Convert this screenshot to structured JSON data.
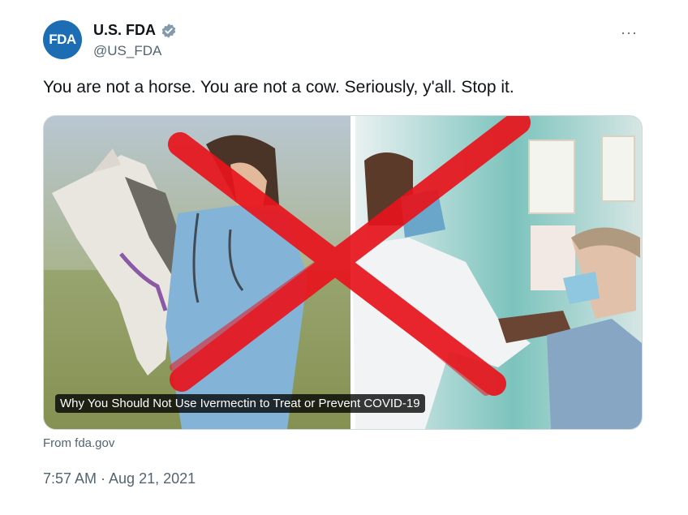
{
  "author": {
    "avatar_text": "FDA",
    "display_name": "U.S. FDA",
    "handle": "@US_FDA",
    "verified_icon": "verified-badge-icon"
  },
  "menu": {
    "more_label": "···"
  },
  "tweet": {
    "text": "You are not a horse. You are not a cow. Seriously, y'all. Stop it."
  },
  "card": {
    "title": "Why You Should Not Use Ivermectin to Treat or Prevent COVID-19",
    "source": "From fda.gov"
  },
  "meta": {
    "timestamp": "7:57 AM · Aug 21, 2021"
  },
  "colors": {
    "brand": "#1d6db5",
    "verified": "#829aab",
    "muted": "#536471",
    "cross": "#e8141c"
  }
}
